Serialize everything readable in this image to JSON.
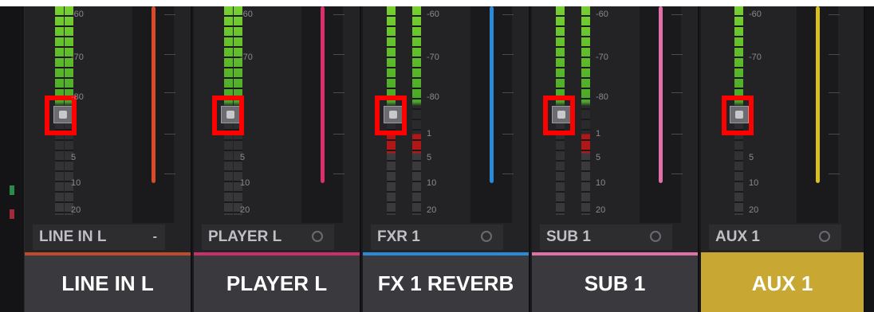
{
  "scale_labels": [
    "-60",
    "-70",
    "-80",
    "1",
    "5",
    "10",
    "20"
  ],
  "channels": [
    {
      "name_field": "LINE IN L",
      "name_suffix": "-",
      "label": "LINE IN L",
      "color": "#d84a2a",
      "accent": "#c04a2a",
      "active": false
    },
    {
      "name_field": "PLAYER L",
      "label": "PLAYER L",
      "color": "#d8306a",
      "accent": "#c8306a",
      "active": false
    },
    {
      "name_field": "FXR 1",
      "label": "FX 1 REVERB",
      "color": "#2a8ad8",
      "accent": "#2a8ad8",
      "active": false
    },
    {
      "name_field": "SUB 1",
      "label": "SUB 1",
      "color": "#e070a8",
      "accent": "#e070a8",
      "active": false
    },
    {
      "name_field": "AUX 1",
      "label": "AUX 1",
      "color": "#d8c020",
      "accent": "#c8a832",
      "active": true
    }
  ],
  "highlight_color": "#ff0000"
}
